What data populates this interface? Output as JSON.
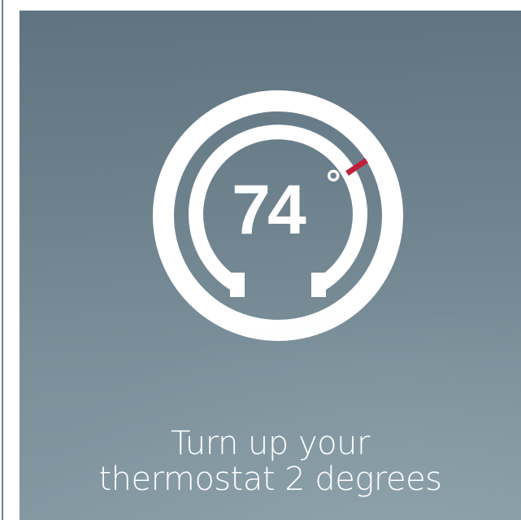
{
  "thermostat": {
    "temperature": "74",
    "degree_symbol": "°",
    "accent_color": "#c0203a",
    "ring_color": "#ffffff"
  },
  "caption": {
    "line1": "Turn up your",
    "line2": "thermostat 2 degrees"
  },
  "colors": {
    "background_top": "#5f7380",
    "background_bottom": "#8499a3",
    "text": "#ffffff"
  }
}
